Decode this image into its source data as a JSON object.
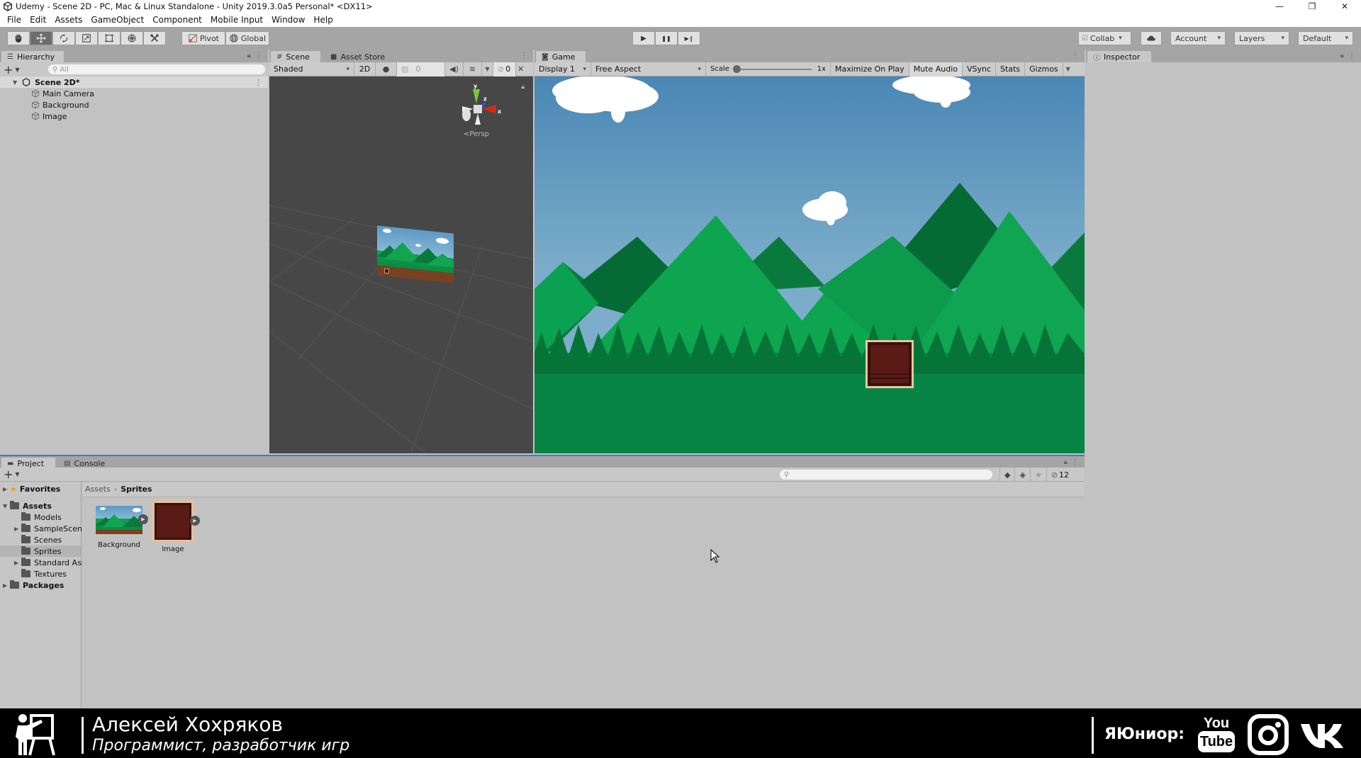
{
  "window": {
    "title": "Udemy - Scene 2D - PC, Mac & Linux Standalone - Unity 2019.3.0a5 Personal* <DX11>",
    "controls": {
      "minimize": "—",
      "restore": "❐",
      "close": "✕"
    }
  },
  "menu": [
    "File",
    "Edit",
    "Assets",
    "GameObject",
    "Component",
    "Mobile Input",
    "Window",
    "Help"
  ],
  "toolbar": {
    "tools": [
      "hand-tool",
      "move-tool",
      "rotate-tool",
      "scale-tool",
      "rect-tool",
      "transform-tool",
      "custom-tool"
    ],
    "active_tool": "move-tool",
    "pivot_label": "Pivot",
    "global_label": "Global",
    "play_icon": "▶",
    "pause_icon": "❚❚",
    "step_icon": "▶❙",
    "collab_label": "Collab",
    "account_label": "Account",
    "layers_label": "Layers",
    "layout_label": "Default"
  },
  "hierarchy": {
    "tab_label": "Hierarchy",
    "add_label": "+",
    "search_placeholder": "All",
    "scene_name": "Scene 2D*",
    "objects": [
      "Main Camera",
      "Background",
      "Image"
    ]
  },
  "scene": {
    "tab_label": "Scene",
    "asset_store_tab_label": "Asset Store",
    "shading_mode": "Shaded",
    "mode_2d_label": "2D",
    "fx_value": "0",
    "hidden_count": "0",
    "persp_label": "Persp",
    "gizmo_axes": {
      "y": "y",
      "z": "z",
      "x": "x"
    }
  },
  "game": {
    "tab_label": "Game",
    "display": "Display 1",
    "aspect": "Free Aspect",
    "scale_label": "Scale",
    "scale_value": "1x",
    "toggles": [
      "Maximize On Play",
      "Mute Audio",
      "VSync",
      "Stats",
      "Gizmos"
    ]
  },
  "inspector": {
    "tab_label": "Inspector"
  },
  "project": {
    "tab_label": "Project",
    "console_tab_label": "Console",
    "add_label": "+",
    "hidden_count": "12",
    "favorites_label": "Favorites",
    "tree": {
      "root": "Assets",
      "children": [
        {
          "name": "Models",
          "expandable": false
        },
        {
          "name": "SampleScenes",
          "expandable": true
        },
        {
          "name": "Scenes",
          "expandable": false
        },
        {
          "name": "Sprites",
          "expandable": false,
          "selected": true
        },
        {
          "name": "Standard Assets",
          "expandable": true
        },
        {
          "name": "Textures",
          "expandable": false
        }
      ],
      "packages": "Packages"
    },
    "breadcrumb": [
      "Assets",
      "Sprites"
    ],
    "assets": [
      {
        "name": "Background",
        "kind": "landscape-sprite"
      },
      {
        "name": "Image",
        "kind": "crate-sprite"
      }
    ]
  },
  "banner": {
    "author_name": "Алексей Хохряков",
    "author_role": "Программист, разработчик игр",
    "brand": "ЯЮниор:",
    "social": [
      "youtube",
      "instagram",
      "vk"
    ],
    "youtube_top": "You",
    "youtube_bottom": "Tube"
  },
  "colors": {
    "toolbar_bg": "#a5a5a5",
    "panel_bg": "#c2c2c2",
    "scene_bg": "#474747",
    "sky_top": "#4a87b5",
    "mountain_light": "#0fa552",
    "mountain_dark": "#0a7a3c",
    "ground": "#088544",
    "crate": "#4a1512"
  }
}
